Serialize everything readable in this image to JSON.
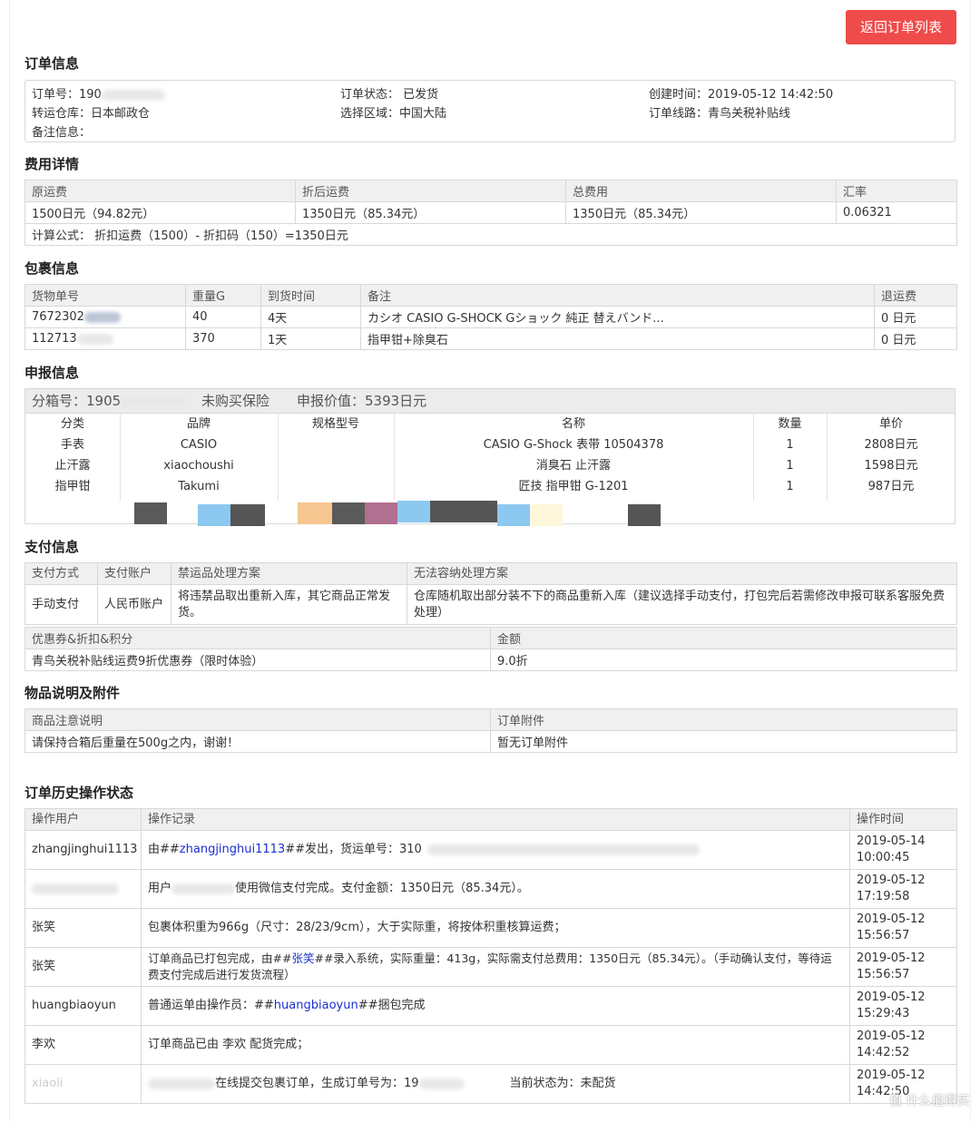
{
  "header": {
    "back_button": "返回订单列表"
  },
  "order_info": {
    "title": "订单信息",
    "order_no_label": "订单号：",
    "order_no_prefix": "190",
    "status_label": "订单状态：",
    "status": "已发货",
    "created_label": "创建时间：",
    "created": "2019-05-12 14:42:50",
    "warehouse_label": "转运仓库：",
    "warehouse": "日本邮政仓",
    "region_label": "选择区域：",
    "region": "中国大陆",
    "route_label": "订单线路：",
    "route": "青鸟关税补贴线",
    "remark_label": "备注信息："
  },
  "fees": {
    "title": "费用详情",
    "headers": [
      "原运费",
      "折后运费",
      "总费用",
      "汇率"
    ],
    "values": [
      "1500日元（94.82元）",
      "1350日元（85.34元）",
      "1350日元（85.34元）",
      "0.06321"
    ],
    "formula": "计算公式： 折扣运费（1500）- 折扣码（150）=1350日元"
  },
  "packages": {
    "title": "包裹信息",
    "headers": [
      "货物单号",
      "重量G",
      "到货时间",
      "备注",
      "退运费"
    ],
    "rows": [
      {
        "no": "7672302",
        "weight": "40",
        "arrival": "4天",
        "note": "カシオ CASIO G-SHOCK Gショック 純正 替えバンド...",
        "refund": "0 日元"
      },
      {
        "no": "112713",
        "weight": "370",
        "arrival": "1天",
        "note": "指甲钳+除臭石",
        "refund": "0 日元"
      }
    ]
  },
  "declaration": {
    "title": "申报信息",
    "box_label": "分箱号：1905",
    "insurance": "未购买保险",
    "value": "申报价值：5393日元",
    "headers": [
      "分类",
      "品牌",
      "规格型号",
      "名称",
      "数量",
      "单价"
    ],
    "rows": [
      {
        "category": "手表",
        "brand": "CASIO",
        "model": "",
        "name": "CASIO G-Shock 表带 10504378",
        "qty": "1",
        "price": "2808日元"
      },
      {
        "category": "止汗露",
        "brand": "xiaochoushi",
        "model": "",
        "name": "消臭石 止汗露",
        "qty": "1",
        "price": "1598日元"
      },
      {
        "category": "指甲钳",
        "brand": "Takumi",
        "model": "",
        "name": "匠技 指甲钳 G-1201",
        "qty": "1",
        "price": "987日元"
      }
    ]
  },
  "payment": {
    "title": "支付信息",
    "headers": [
      "支付方式",
      "支付账户",
      "禁运品处理方案",
      "无法容纳处理方案"
    ],
    "values": [
      "手动支付",
      "人民币账户",
      "将违禁品取出重新入库，其它商品正常发货。",
      "仓库随机取出部分装不下的商品重新入库（建议选择手动支付，打包完后若需修改申报可联系客服免费处理）"
    ],
    "coupon_headers": [
      "优惠券&折扣&积分",
      "金额"
    ],
    "coupon_values": [
      "青鸟关税补贴线运费9折优惠券（限时体验）",
      "9.0折"
    ]
  },
  "items": {
    "title": "物品说明及附件",
    "headers": [
      "商品注意说明",
      "订单附件"
    ],
    "values": [
      "请保持合箱后重量在500g之内，谢谢！",
      "暂无订单附件"
    ]
  },
  "history": {
    "title": "订单历史操作状态",
    "headers": [
      "操作用户",
      "操作记录",
      "操作时间"
    ],
    "rows": [
      {
        "user": "zhangjinghui1113",
        "pre": "由##",
        "link": "zhangjinghui1113",
        "post": "##发出，货运单号：310",
        "date": "2019-05-14",
        "time": "10:00:45"
      },
      {
        "user": "",
        "pre": "用户",
        "link": "",
        "post": "使用微信支付完成。支付金额：1350日元（85.34元）。",
        "date": "2019-05-12",
        "time": "17:19:58"
      },
      {
        "user": "张笑",
        "pre": "包裹体积重为966g（尺寸：28/23/9cm），大于实际重，将按体积重核算运费；",
        "link": "",
        "post": "",
        "date": "2019-05-12",
        "time": "15:56:57"
      },
      {
        "user": "张笑",
        "pre": "订单商品已打包完成，由##",
        "link": "张笑",
        "post": "##录入系统，实际重量：413g，实际需支付总费用：1350日元（85.34元）。（手动确认支付，等待运费支付完成后进行发货流程）",
        "date": "2019-05-12",
        "time": "15:56:57"
      },
      {
        "user": "huangbiaoyun",
        "pre": "普通运单由操作员：##",
        "link": "huangbiaoyun",
        "post": "##捆包完成",
        "date": "2019-05-12",
        "time": "15:29:43"
      },
      {
        "user": "李欢",
        "pre": "订单商品已由 李欢 配货完成；",
        "link": "",
        "post": "",
        "date": "2019-05-12",
        "time": "14:42:52"
      },
      {
        "user": "xiaoli",
        "pre": "在线提交包裹订单，生成订单号为：19",
        "link": "",
        "post": "当前状态为：未配货",
        "date": "2019-05-12",
        "time": "14:42:50"
      }
    ]
  },
  "watermark": "值 什么值得买"
}
